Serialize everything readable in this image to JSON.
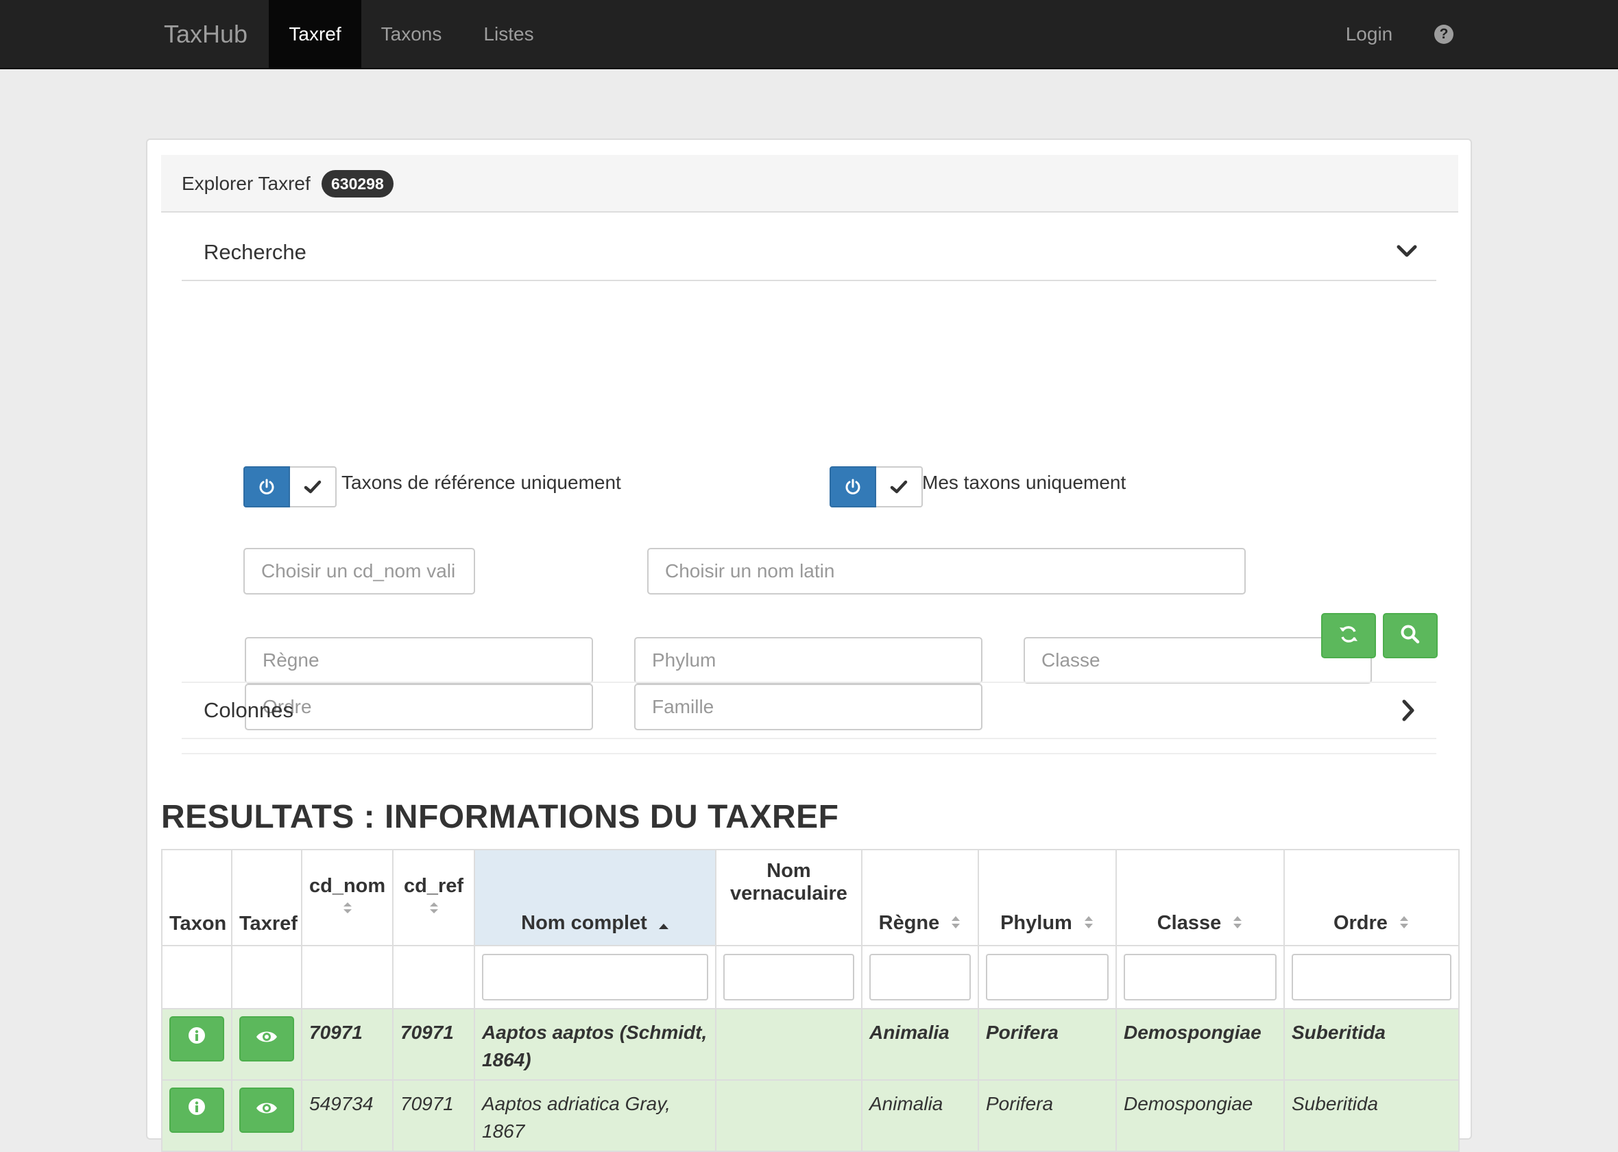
{
  "navbar": {
    "brand": "TaxHub",
    "items": [
      {
        "label": "Taxref",
        "active": true
      },
      {
        "label": "Taxons",
        "active": false
      },
      {
        "label": "Listes",
        "active": false
      }
    ],
    "login": "Login",
    "help_icon": "question-circle-icon"
  },
  "panel": {
    "title": "Explorer Taxref",
    "count": "630298"
  },
  "search": {
    "title": "Recherche",
    "toggle_reference": "Taxons de référence uniquement",
    "toggle_mine": "Mes taxons uniquement",
    "cd_nom_placeholder": "Choisir un cd_nom vali",
    "nom_latin_placeholder": "Choisir un nom latin",
    "regne_placeholder": "Règne",
    "phylum_placeholder": "Phylum",
    "classe_placeholder": "Classe",
    "ordre_placeholder": "Ordre",
    "famille_placeholder": "Famille",
    "reset_icon": "refresh-icon",
    "search_icon": "search-icon"
  },
  "colonnes": {
    "title": "Colonnes"
  },
  "results": {
    "title": "RESULTATS : INFORMATIONS DU TAXREF",
    "headers": {
      "taxon": "Taxon",
      "taxref": "Taxref",
      "cd_nom": "cd_nom",
      "cd_ref": "cd_ref",
      "nom_complet": "Nom complet",
      "nom_vern_1": "Nom",
      "nom_vern_2": "vernaculaire",
      "regne": "Règne",
      "phylum": "Phylum",
      "classe": "Classe",
      "ordre": "Ordre"
    },
    "rows": [
      {
        "cd_nom": "70971",
        "cd_ref": "70971",
        "nom_complet": "Aaptos aaptos (Schmidt, 1864)",
        "nom_vern": "",
        "regne": "Animalia",
        "phylum": "Porifera",
        "classe": "Demospongiae",
        "ordre": "Suberitida"
      },
      {
        "cd_nom": "549734",
        "cd_ref": "70971",
        "nom_complet": "Aaptos adriatica Gray, 1867",
        "nom_vern": "",
        "regne": "Animalia",
        "phylum": "Porifera",
        "classe": "Demospongiae",
        "ordre": "Suberitida"
      }
    ]
  },
  "colors": {
    "navbar": "#222222",
    "primary": "#337ab7",
    "success": "#5cb85c",
    "row_highlight": "#dff0d8",
    "sorted_header": "#dfeaf3"
  }
}
